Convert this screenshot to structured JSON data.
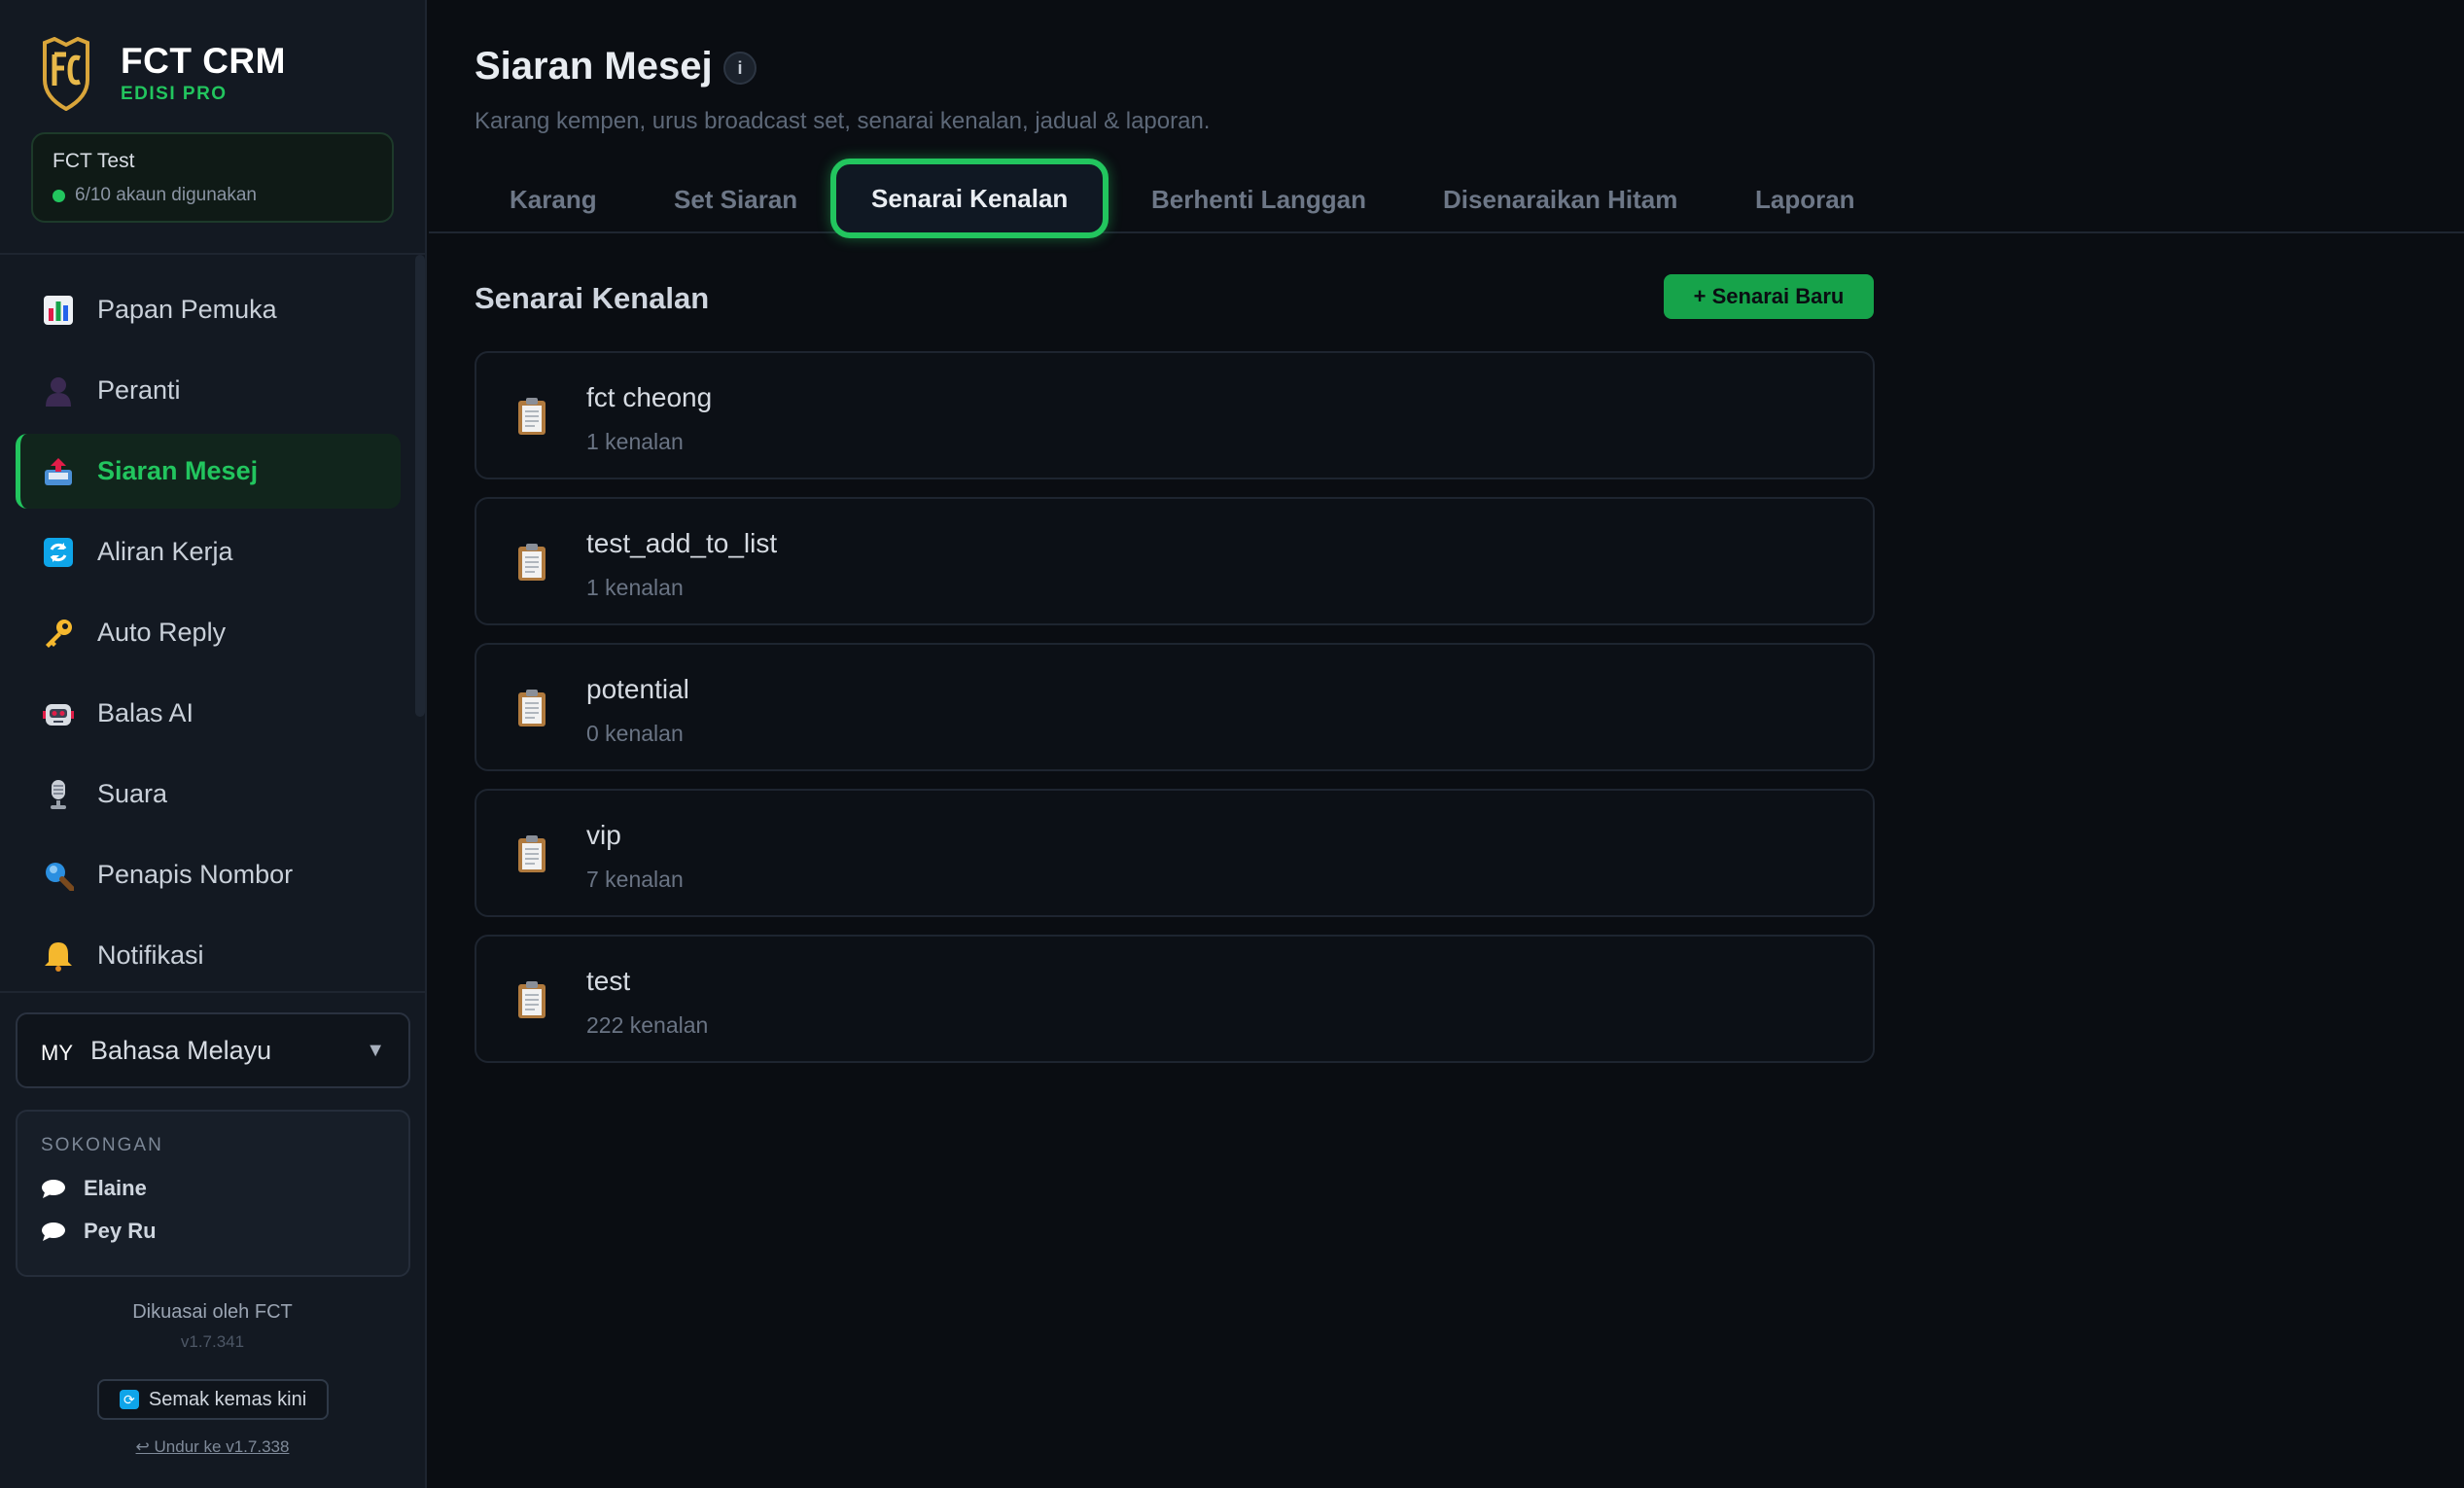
{
  "brand": {
    "title": "FCT CRM",
    "subtitle": "EDISI PRO"
  },
  "account": {
    "name": "FCT Test",
    "usage": "6/10 akaun digunakan"
  },
  "sidebar": {
    "items": [
      {
        "label": "Papan Pemuka",
        "icon": "bar-chart-icon",
        "active": false
      },
      {
        "label": "Peranti",
        "icon": "user-silhouette-icon",
        "active": false
      },
      {
        "label": "Siaran Mesej",
        "icon": "outbox-tray-icon",
        "active": true
      },
      {
        "label": "Aliran Kerja",
        "icon": "refresh-icon",
        "active": false
      },
      {
        "label": "Auto Reply",
        "icon": "key-icon",
        "active": false
      },
      {
        "label": "Balas AI",
        "icon": "robot-icon",
        "active": false
      },
      {
        "label": "Suara",
        "icon": "microphone-icon",
        "active": false
      },
      {
        "label": "Penapis Nombor",
        "icon": "magnifier-icon",
        "active": false
      },
      {
        "label": "Notifikasi",
        "icon": "bell-icon",
        "active": false
      }
    ],
    "language": {
      "code": "MY",
      "label": "Bahasa Melayu"
    },
    "support": {
      "title": "SOKONGAN",
      "contacts": [
        "Elaine",
        "Pey Ru"
      ]
    },
    "powered_by": "Dikuasai oleh FCT",
    "version": "v1.7.341",
    "update_label": "Semak kemas kini",
    "downgrade_label": "↩ Undur ke v1.7.338"
  },
  "page": {
    "title": "Siaran Mesej",
    "subtitle": "Karang kempen, urus broadcast set, senarai kenalan, jadual & laporan."
  },
  "tabs": [
    {
      "label": "Karang",
      "active": false
    },
    {
      "label": "Set Siaran",
      "active": false
    },
    {
      "label": "Senarai Kenalan",
      "active": true
    },
    {
      "label": "Berhenti Langgan",
      "active": false
    },
    {
      "label": "Disenaraikan Hitam",
      "active": false
    },
    {
      "label": "Laporan",
      "active": false
    }
  ],
  "section": {
    "title": "Senarai Kenalan",
    "new_button": "+ Senarai Baru"
  },
  "contact_lists": [
    {
      "name": "fct cheong",
      "count": "1 kenalan"
    },
    {
      "name": "test_add_to_list",
      "count": "1 kenalan"
    },
    {
      "name": "potential",
      "count": "0 kenalan"
    },
    {
      "name": "vip",
      "count": "7 kenalan"
    },
    {
      "name": "test",
      "count": "222 kenalan"
    }
  ],
  "colors": {
    "accent": "#22c55e",
    "button": "#16a34a",
    "background": "#0a0d12",
    "sidebar": "#131922"
  }
}
